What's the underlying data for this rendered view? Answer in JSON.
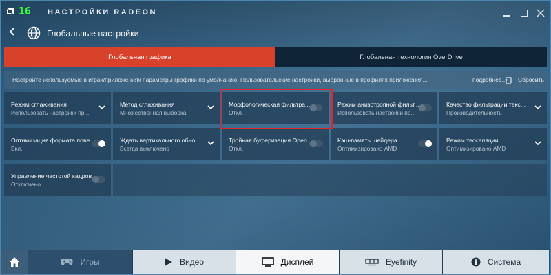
{
  "titlebar": {
    "logo": "AMD",
    "logo_number": "16",
    "app_title": "НАСТРОЙКИ RADEON"
  },
  "header": {
    "title": "Глобальные настройки"
  },
  "tabs": [
    {
      "label": "Глобальная графика",
      "active": true
    },
    {
      "label": "Глобальная технология OverDrive",
      "active": false
    }
  ],
  "description": {
    "text": "Настройте используемые в играх/приложениях параметры графики по умолчанию.  Пользовательские настройки, выбранные в профилях приложения...",
    "more": "подробнее...",
    "reset": "Сбросить"
  },
  "settings": [
    {
      "label": "Режим сглаживания",
      "value": "Использовать настройки пр...",
      "control": "dropdown"
    },
    {
      "label": "Метод сглаживания",
      "value": "Множественная выборка",
      "control": "dropdown"
    },
    {
      "label": "Морфологическая фильтра...",
      "value": "Откл.",
      "control": "toggle-off"
    },
    {
      "label": "Режим анизотропной фильт...",
      "value": "Использовать настройки пр...",
      "control": "toggle-off"
    },
    {
      "label": "Качество фильтрации текс...",
      "value": "Производительность",
      "control": "dropdown"
    },
    {
      "label": "Оптимизация формата пове...",
      "value": "Вкл.",
      "control": "toggle-on"
    },
    {
      "label": "Ждать вертикального обно...",
      "value": "Всегда выключено",
      "control": "dropdown"
    },
    {
      "label": "Тройная буферизация Open...",
      "value": "Откл.",
      "control": "toggle-off"
    },
    {
      "label": "Кэш-память шейдера",
      "value": "Оптимизировано AMD",
      "control": "toggle-on"
    },
    {
      "label": "Режим тесселяции",
      "value": "Оптимизировано AMD",
      "control": "dropdown"
    },
    {
      "label": "Управление частотой кадров",
      "value": "Отключено",
      "control": "toggle-off"
    }
  ],
  "bottom_nav": [
    {
      "label": "Игры",
      "icon": "gamepad-icon"
    },
    {
      "label": "Видео",
      "icon": "play-icon"
    },
    {
      "label": "Дисплей",
      "icon": "monitor-icon"
    },
    {
      "label": "Eyefinity",
      "icon": "eyefinity-icon"
    },
    {
      "label": "Система",
      "icon": "info-icon"
    }
  ],
  "colors": {
    "accent": "#d9422a",
    "highlight_border": "#e0262b"
  }
}
